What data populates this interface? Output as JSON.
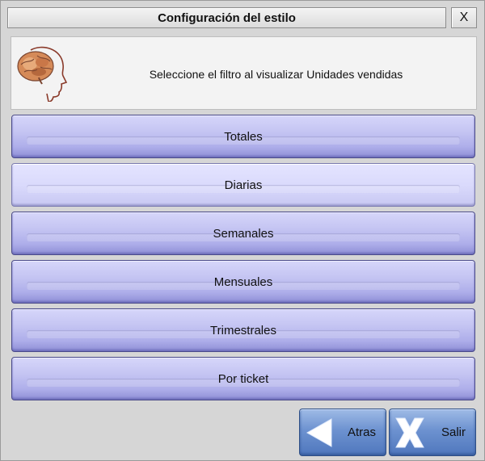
{
  "window": {
    "title": "Configuración del estilo",
    "close_label": "X"
  },
  "header": {
    "icon": "brain-head-icon",
    "message": "Seleccione el filtro al visualizar Unidades vendidas"
  },
  "options": [
    {
      "label": "Totales",
      "selected": false
    },
    {
      "label": "Diarias",
      "selected": true
    },
    {
      "label": "Semanales",
      "selected": false
    },
    {
      "label": "Mensuales",
      "selected": false
    },
    {
      "label": "Trimestrales",
      "selected": false
    },
    {
      "label": "Por ticket",
      "selected": false
    }
  ],
  "footer": {
    "back_label": "Atras",
    "back_icon": "back-arrow-icon",
    "exit_label": "Salir",
    "exit_icon": "exit-x-icon"
  },
  "colors": {
    "option_button": "#b4b4ec",
    "option_selected": "#dadafc",
    "nav_button": "#6d92d0"
  }
}
